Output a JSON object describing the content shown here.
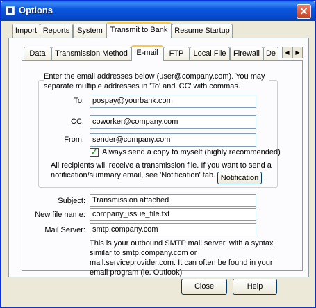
{
  "window": {
    "title": "Options",
    "icons": {
      "app": "options-app-icon",
      "close": "close-icon"
    },
    "close_glyph": "✕"
  },
  "top_tabs": [
    "Import",
    "Reports",
    "System",
    "Transmit to Bank",
    "Resume Startup"
  ],
  "sub_tabs": [
    "Data",
    "Transmission Method",
    "E-mail",
    "FTP",
    "Local File",
    "Firewall",
    "De"
  ],
  "scroll": {
    "left": "◀",
    "right": "▶"
  },
  "email": {
    "instructions": "Enter the email addresses below (user@company.com).  You may separate multiple addresses in 'To' and 'CC' with commas.",
    "to_label": "To:",
    "to_value": "pospay@yourbank.com",
    "cc_label": "CC:",
    "cc_value": "coworker@company.com",
    "from_label": "From:",
    "from_value": "sender@company.com",
    "copy_checkbox_label": "Always send a copy to myself (highly recommended)",
    "copy_checked": true,
    "check_glyph": "✓",
    "notification_text": "All recipients will receive a transmission file.  If you want to send a notification/summary email, see 'Notification' tab.",
    "notification_button": "Notification",
    "subject_label": "Subject:",
    "subject_value": "Transmission attached",
    "filename_label": "New file name:",
    "filename_value": "company_issue_file.txt",
    "server_label": "Mail Server:",
    "server_value": "smtp.company.com",
    "server_help": "This is your outbound SMTP mail server, with a syntax similar to smtp.company.com or mail.serviceprovider.com.  It can often be found in your email program (ie. Outlook)"
  },
  "footer": {
    "close_button": "Close",
    "help_button": "Help"
  },
  "colors": {
    "titlebar": "#0a58df",
    "face": "#ece9d8",
    "tab_highlight": "#ffc83c"
  }
}
